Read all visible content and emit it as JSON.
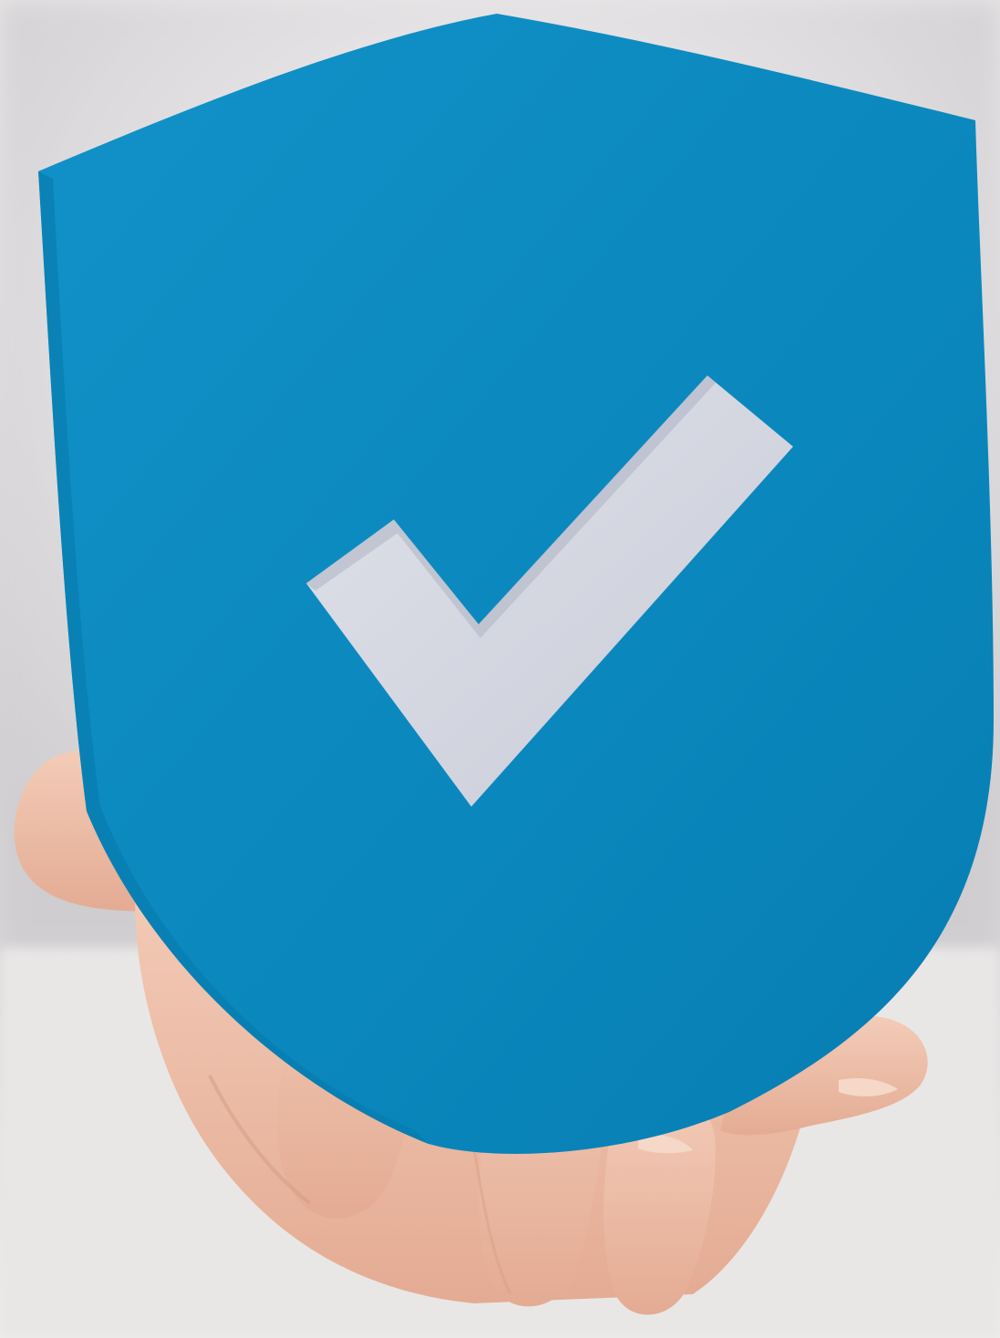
{
  "photo": {
    "subject": "hand-holding-shield",
    "icon": "shield-check-icon"
  },
  "colors": {
    "shield": "#0b8bc2",
    "shield_edge": "#087cad",
    "checkmark": "#d6d9e3",
    "skin": "#f1c6b0",
    "skin_shadow": "#dca089",
    "background_top": "#e8e4e5",
    "background_bottom": "#eceae9",
    "shirt": "#f2f0f1"
  }
}
